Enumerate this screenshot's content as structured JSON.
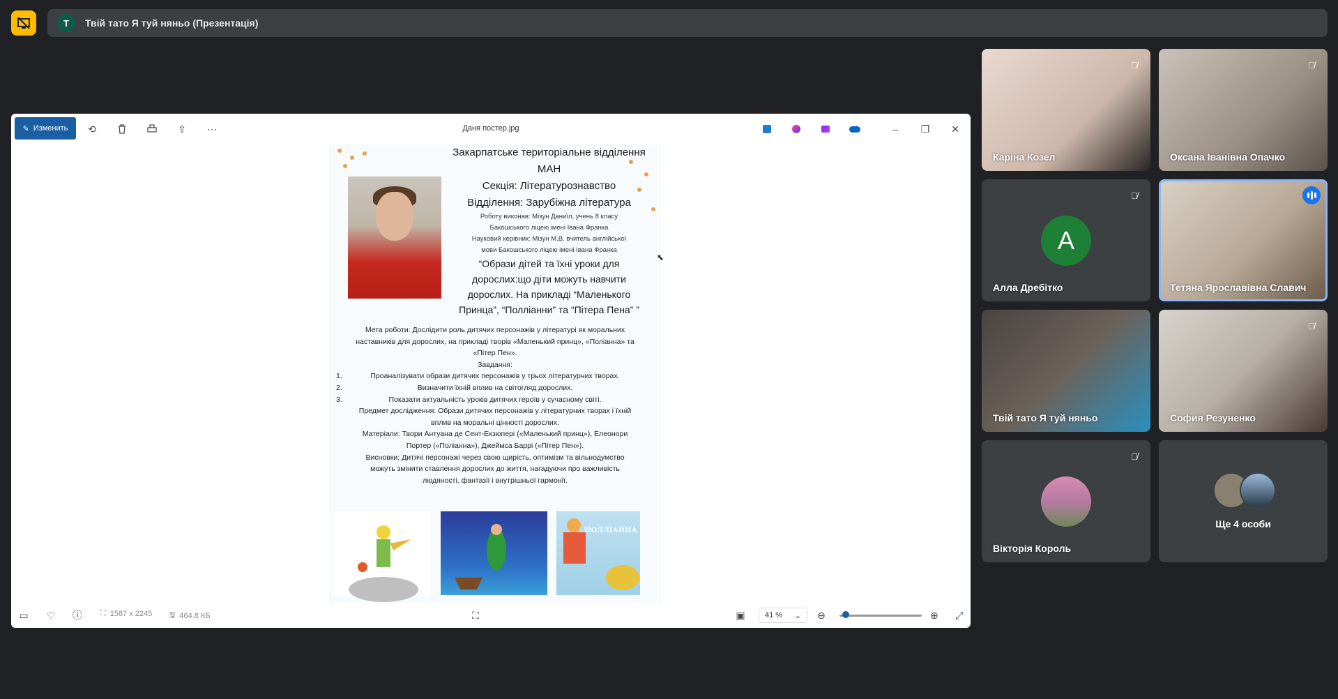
{
  "meeting": {
    "presenter_initial": "T",
    "presentation_title": "Твій тато Я туй няньо (Презентація)"
  },
  "viewer": {
    "edit_label": "Изменить",
    "file_name": "Даня постер.jpg",
    "dimensions": "1587 x 2245",
    "file_size": "464.8 КБ",
    "zoom": "41 %"
  },
  "poster": {
    "org_line1": "Закарпатське територіальне відділення",
    "org_line2": "МАН",
    "section": "Секція: Літературознавство",
    "department": "Відділення: Зарубіжна література",
    "author_line1": "Роботу виконав: Мізун Даниїл, учень 8 класу",
    "author_line2": "Бакошського ліцею імені Івана Франка",
    "supervisor_line1": "Науковий керівник: Мізун М.В. вчитель англійської",
    "supervisor_line2": "мови Бакошського ліцею імені Івана Франка",
    "topic_line1": "“Образи дітей та їхні уроки для",
    "topic_line2": "дорослих:що діти можуть навчити",
    "topic_line3": "дорослих. На прикладі “Маленького",
    "topic_line4": "Принца”, “Полліанни” та “Пітера Пена” ”",
    "goal_line1": "Мета роботи: Дослідити роль дитячих персонажів у літературі як моральних",
    "goal_line2": "наставників для дорослих, на прикладі творів «Маленький принц», «Поліанна» та",
    "goal_line3": "«Пітер Пен».",
    "tasks_title": "Завдання:",
    "task_1_num": "1.",
    "task_1": "Проаналізувати образи дитячих персонажів у трьох літературних творах.",
    "task_2_num": "2.",
    "task_2": "Визначити їхній вплив на світогляд дорослих.",
    "task_3_num": "3.",
    "task_3": "Показати актуальність уроків дитячих героїв у сучасному світі.",
    "subject_line1": "Предмет дослідження: Образи дитячих персонажів у літературних творах і їхній",
    "subject_line2": "вплив на моральні цінності дорослих.",
    "materials_line1": "Матеріали: Твори Антуана де Сент-Екзюпері («Маленький принц»), Елеонори",
    "materials_line2": "Портер («Поліанна»), Джеймса Баррі («Пітер Пен»).",
    "conclusions_line1": "Висновки: Дитячі персонажі через свою щирість, оптимізм та вільнодумство",
    "conclusions_line2": "можуть змінити ставлення дорослих до життя, нагадуючи про важливість",
    "conclusions_line3": "людяності, фантазії і внутрішньої гармонії.",
    "book_title": "ПОЛЛІАННА"
  },
  "participants": [
    {
      "name": "Каріна Козел",
      "muted": true
    },
    {
      "name": "Оксана Іванівна Опачко",
      "muted": true
    },
    {
      "name": "Алла Дребітко",
      "muted": true,
      "initial": "A"
    },
    {
      "name": "Тетяна Ярославівна Славич",
      "muted": false,
      "speaking": true
    },
    {
      "name": "Твій тато Я туй няньо",
      "muted": false
    },
    {
      "name": "София Резуненко",
      "muted": true
    },
    {
      "name": "Вікторія Король",
      "muted": true
    },
    {
      "name": "Ще 4 особи"
    }
  ],
  "colors": {
    "background": "#202124",
    "tile": "#3c4043",
    "accent": "#8ab4f8",
    "present_icon": "#fbbc04",
    "edit_button": "#1a5fa3"
  }
}
